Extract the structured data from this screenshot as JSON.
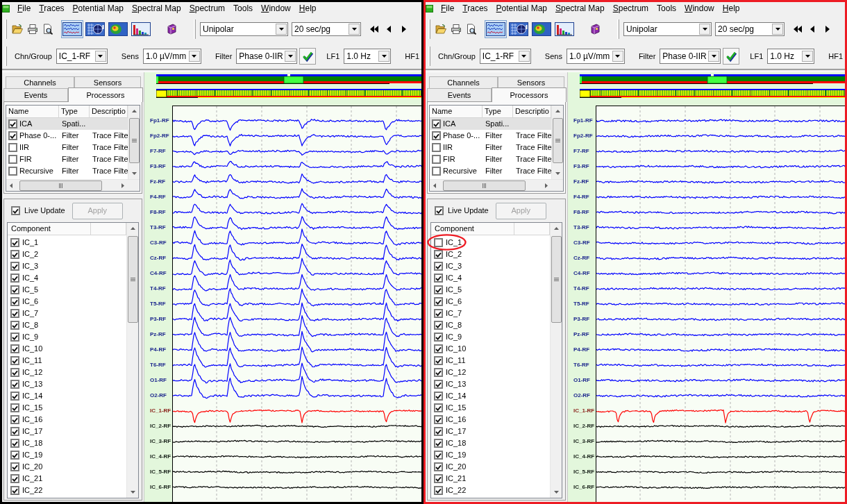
{
  "windows": [
    {
      "color": "#000000",
      "menu": [
        {
          "label": "File",
          "mnemonic": true
        },
        {
          "label": "Traces",
          "mnemonic": true
        },
        {
          "label": "Potential Map",
          "mnemonic": true
        },
        {
          "label": "Spectral Map",
          "mnemonic": true
        },
        {
          "label": "Spectrum",
          "mnemonic": true
        },
        {
          "label": "Tools",
          "mnemonic": false
        },
        {
          "label": "Window",
          "mnemonic": true
        },
        {
          "label": "Help",
          "mnemonic": true
        }
      ],
      "view_buttons": [
        {
          "kind": "traces",
          "selected": true
        },
        {
          "kind": "head-map",
          "selected": false
        },
        {
          "kind": "color-map",
          "selected": false
        },
        {
          "kind": "spectrum",
          "selected": false
        }
      ],
      "montage": {
        "value": "Unipolar"
      },
      "page_length": {
        "value": "20 sec/pg"
      },
      "settings": [
        {
          "kind": "combo",
          "label": "Chn/Group",
          "value": "IC_1-RF"
        },
        {
          "kind": "combo",
          "label": "Sens",
          "value": "1.0 µV/mm"
        },
        {
          "kind": "combo",
          "label": "Filter",
          "value": "Phase 0-IIR"
        },
        {
          "kind": "check"
        },
        {
          "kind": "combo",
          "label": "LF1",
          "value": "1.0 Hz"
        },
        {
          "kind": "label",
          "label": "HF1"
        }
      ],
      "side_tabs": [
        {
          "label": "Channels",
          "selected": false
        },
        {
          "label": "Sensors",
          "selected": false
        },
        {
          "label": "Events",
          "selected": false
        },
        {
          "label": "Processors",
          "selected": true
        }
      ],
      "processors": {
        "columns": [
          "Name",
          "Type",
          "Descriptio"
        ],
        "rows": [
          {
            "name": "ICA",
            "type": "Spati...",
            "checked": true,
            "selected": true
          },
          {
            "name": "Phase 0-...",
            "type": "Filter",
            "description": "Trace Filte",
            "checked": true,
            "selected": false
          },
          {
            "name": "IIR",
            "type": "Filter",
            "description": "Trace Filte",
            "checked": false,
            "selected": false
          },
          {
            "name": "FIR",
            "type": "Filter",
            "description": "Trace Filte",
            "checked": false,
            "selected": false
          },
          {
            "name": "Recursive",
            "type": "Filter",
            "description": "Trace Filte",
            "checked": false,
            "selected": false
          }
        ]
      },
      "live_update": {
        "label": "Live Update",
        "checked": true
      },
      "apply_button": {
        "label": "Apply",
        "disabled": true
      },
      "components": {
        "columns": [
          "Component"
        ],
        "items": [
          {
            "label": "IC_1",
            "checked": true,
            "circled": false
          },
          {
            "label": "IC_2",
            "checked": true,
            "circled": false
          },
          {
            "label": "IC_3",
            "checked": true,
            "circled": false
          },
          {
            "label": "IC_4",
            "checked": true,
            "circled": false
          },
          {
            "label": "IC_5",
            "checked": true,
            "circled": false
          },
          {
            "label": "IC_6",
            "checked": true,
            "circled": false
          },
          {
            "label": "IC_7",
            "checked": true,
            "circled": false
          },
          {
            "label": "IC_8",
            "checked": true,
            "circled": false
          },
          {
            "label": "IC_9",
            "checked": true,
            "circled": false
          },
          {
            "label": "IC_10",
            "checked": true,
            "circled": false
          },
          {
            "label": "IC_11",
            "checked": true,
            "circled": false
          },
          {
            "label": "IC_12",
            "checked": true,
            "circled": false
          },
          {
            "label": "IC_13",
            "checked": true,
            "circled": false
          },
          {
            "label": "IC_14",
            "checked": true,
            "circled": false
          },
          {
            "label": "IC_15",
            "checked": true,
            "circled": false
          },
          {
            "label": "IC_16",
            "checked": true,
            "circled": false
          },
          {
            "label": "IC_17",
            "checked": true,
            "circled": false
          },
          {
            "label": "IC_18",
            "checked": true,
            "circled": false
          },
          {
            "label": "IC_19",
            "checked": true,
            "circled": false
          },
          {
            "label": "IC_20",
            "checked": true,
            "circled": false
          },
          {
            "label": "IC_21",
            "checked": true,
            "circled": false
          },
          {
            "label": "IC_22",
            "checked": true,
            "circled": false
          }
        ]
      },
      "channels": [
        {
          "label": "Fp1-RF",
          "color": "#0000ff",
          "blinks": true
        },
        {
          "label": "Fp2-RF",
          "color": "#0000ff",
          "blinks": true
        },
        {
          "label": "F7-RF",
          "color": "#0000ff",
          "blinks": true
        },
        {
          "label": "F3-RF",
          "color": "#0000ff",
          "blinks": true
        },
        {
          "label": "Fz-RF",
          "color": "#0000ff",
          "blinks": true
        },
        {
          "label": "F4-RF",
          "color": "#0000ff",
          "blinks": true
        },
        {
          "label": "F8-RF",
          "color": "#0000ff",
          "blinks": true
        },
        {
          "label": "T3-RF",
          "color": "#0000ff",
          "blinks": true
        },
        {
          "label": "C3-RF",
          "color": "#0000ff",
          "blinks": true
        },
        {
          "label": "Cz-RF",
          "color": "#0000ff",
          "blinks": true
        },
        {
          "label": "C4-RF",
          "color": "#0000ff",
          "blinks": true
        },
        {
          "label": "T4-RF",
          "color": "#0000ff",
          "blinks": true
        },
        {
          "label": "T5-RF",
          "color": "#0000ff",
          "blinks": true
        },
        {
          "label": "P3-RF",
          "color": "#0000ff",
          "blinks": true
        },
        {
          "label": "Pz-RF",
          "color": "#0000ff",
          "blinks": true
        },
        {
          "label": "P4-RF",
          "color": "#0000ff",
          "blinks": true
        },
        {
          "label": "T6-RF",
          "color": "#0000ff",
          "blinks": true
        },
        {
          "label": "O1-RF",
          "color": "#0000ff",
          "blinks": true
        },
        {
          "label": "O2-RF",
          "color": "#0000ff",
          "blinks": true
        },
        {
          "label": "IC_1-RF",
          "color": "#ff0000",
          "blinks": true
        },
        {
          "label": "IC_2-RF",
          "color": "#000000",
          "blinks": false
        },
        {
          "label": "IC_3-RF",
          "color": "#000000",
          "blinks": false
        },
        {
          "label": "IC_4-RF",
          "color": "#000000",
          "blinks": false
        },
        {
          "label": "IC_5-RF",
          "color": "#000000",
          "blinks": false
        },
        {
          "label": "IC_6-RF",
          "color": "#000000",
          "blinks": false
        }
      ]
    },
    {
      "color": "#ed1c24",
      "menu": [
        {
          "label": "File",
          "mnemonic": true
        },
        {
          "label": "Traces",
          "mnemonic": true
        },
        {
          "label": "Potential Map",
          "mnemonic": true
        },
        {
          "label": "Spectral Map",
          "mnemonic": true
        },
        {
          "label": "Spectrum",
          "mnemonic": true
        },
        {
          "label": "Tools",
          "mnemonic": false
        },
        {
          "label": "Window",
          "mnemonic": true
        },
        {
          "label": "Help",
          "mnemonic": true
        }
      ],
      "view_buttons": [
        {
          "kind": "traces",
          "selected": true
        },
        {
          "kind": "head-map",
          "selected": false
        },
        {
          "kind": "color-map",
          "selected": false
        },
        {
          "kind": "spectrum",
          "selected": false
        }
      ],
      "montage": {
        "value": "Unipolar"
      },
      "page_length": {
        "value": "20 sec/pg"
      },
      "settings": [
        {
          "kind": "combo",
          "label": "Chn/Group",
          "value": "IC_1-RF"
        },
        {
          "kind": "combo",
          "label": "Sens",
          "value": "1.0 µV/mm"
        },
        {
          "kind": "combo",
          "label": "Filter",
          "value": "Phase 0-IIR"
        },
        {
          "kind": "check"
        },
        {
          "kind": "combo",
          "label": "LF1",
          "value": "1.0 Hz"
        },
        {
          "kind": "label",
          "label": "HF1"
        }
      ],
      "side_tabs": [
        {
          "label": "Channels",
          "selected": false
        },
        {
          "label": "Sensors",
          "selected": false
        },
        {
          "label": "Events",
          "selected": false
        },
        {
          "label": "Processors",
          "selected": true
        }
      ],
      "processors": {
        "columns": [
          "Name",
          "Type",
          "Descriptio"
        ],
        "rows": [
          {
            "name": "ICA",
            "type": "Spati...",
            "checked": true,
            "selected": true
          },
          {
            "name": "Phase 0-...",
            "type": "Filter",
            "description": "Trace Filte",
            "checked": true,
            "selected": false
          },
          {
            "name": "IIR",
            "type": "Filter",
            "description": "Trace Filte",
            "checked": false,
            "selected": false
          },
          {
            "name": "FIR",
            "type": "Filter",
            "description": "Trace Filte",
            "checked": false,
            "selected": false
          },
          {
            "name": "Recursive",
            "type": "Filter",
            "description": "Trace Filte",
            "checked": false,
            "selected": false
          }
        ]
      },
      "live_update": {
        "label": "Live Update",
        "checked": true
      },
      "apply_button": {
        "label": "Apply",
        "disabled": true
      },
      "components": {
        "columns": [
          "Component"
        ],
        "items": [
          {
            "label": "IC_1",
            "checked": false,
            "circled": true
          },
          {
            "label": "IC_2",
            "checked": true,
            "circled": false
          },
          {
            "label": "IC_3",
            "checked": true,
            "circled": false
          },
          {
            "label": "IC_4",
            "checked": true,
            "circled": false
          },
          {
            "label": "IC_5",
            "checked": true,
            "circled": false
          },
          {
            "label": "IC_6",
            "checked": true,
            "circled": false
          },
          {
            "label": "IC_7",
            "checked": true,
            "circled": false
          },
          {
            "label": "IC_8",
            "checked": true,
            "circled": false
          },
          {
            "label": "IC_9",
            "checked": true,
            "circled": false
          },
          {
            "label": "IC_10",
            "checked": true,
            "circled": false
          },
          {
            "label": "IC_11",
            "checked": true,
            "circled": false
          },
          {
            "label": "IC_12",
            "checked": true,
            "circled": false
          },
          {
            "label": "IC_13",
            "checked": true,
            "circled": false
          },
          {
            "label": "IC_14",
            "checked": true,
            "circled": false
          },
          {
            "label": "IC_15",
            "checked": true,
            "circled": false
          },
          {
            "label": "IC_16",
            "checked": true,
            "circled": false
          },
          {
            "label": "IC_17",
            "checked": true,
            "circled": false
          },
          {
            "label": "IC_18",
            "checked": true,
            "circled": false
          },
          {
            "label": "IC_19",
            "checked": true,
            "circled": false
          },
          {
            "label": "IC_20",
            "checked": true,
            "circled": false
          },
          {
            "label": "IC_21",
            "checked": true,
            "circled": false
          },
          {
            "label": "IC_22",
            "checked": true,
            "circled": false
          }
        ]
      },
      "channels": [
        {
          "label": "Fp1-RF",
          "color": "#0000ff",
          "blinks": false
        },
        {
          "label": "Fp2-RF",
          "color": "#0000ff",
          "blinks": false
        },
        {
          "label": "F7-RF",
          "color": "#0000ff",
          "blinks": false
        },
        {
          "label": "F3-RF",
          "color": "#0000ff",
          "blinks": false
        },
        {
          "label": "Fz-RF",
          "color": "#0000ff",
          "blinks": false
        },
        {
          "label": "F4-RF",
          "color": "#0000ff",
          "blinks": false
        },
        {
          "label": "F8-RF",
          "color": "#0000ff",
          "blinks": false
        },
        {
          "label": "T3-RF",
          "color": "#0000ff",
          "blinks": false
        },
        {
          "label": "C3-RF",
          "color": "#0000ff",
          "blinks": false
        },
        {
          "label": "Cz-RF",
          "color": "#0000ff",
          "blinks": false
        },
        {
          "label": "C4-RF",
          "color": "#0000ff",
          "blinks": false
        },
        {
          "label": "T4-RF",
          "color": "#0000ff",
          "blinks": false
        },
        {
          "label": "T5-RF",
          "color": "#0000ff",
          "blinks": false
        },
        {
          "label": "P3-RF",
          "color": "#0000ff",
          "blinks": false
        },
        {
          "label": "Pz-RF",
          "color": "#0000ff",
          "blinks": false
        },
        {
          "label": "P4-RF",
          "color": "#0000ff",
          "blinks": false
        },
        {
          "label": "T6-RF",
          "color": "#0000ff",
          "blinks": false
        },
        {
          "label": "O1-RF",
          "color": "#0000ff",
          "blinks": false
        },
        {
          "label": "O2-RF",
          "color": "#0000ff",
          "blinks": false
        },
        {
          "label": "IC_1-RF",
          "color": "#ff0000",
          "blinks": true
        },
        {
          "label": "IC_2-RF",
          "color": "#000000",
          "blinks": false
        },
        {
          "label": "IC_3-RF",
          "color": "#000000",
          "blinks": false
        },
        {
          "label": "IC_4-RF",
          "color": "#000000",
          "blinks": false
        },
        {
          "label": "IC_5-RF",
          "color": "#000000",
          "blinks": false
        },
        {
          "label": "IC_6-RF",
          "color": "#000000",
          "blinks": false
        }
      ]
    }
  ]
}
